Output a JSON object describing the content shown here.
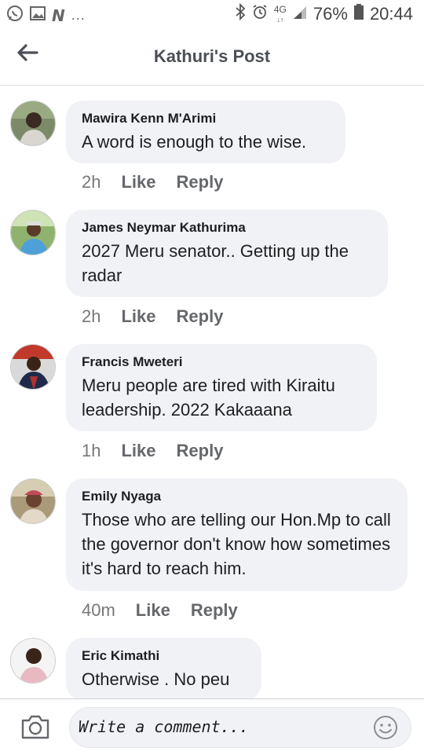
{
  "status_bar": {
    "icons_left": [
      "whatsapp-icon",
      "image-icon",
      "n-icon"
    ],
    "n_glyph": "N",
    "more": "...",
    "icons_right": [
      "bluetooth-icon",
      "alarm-icon",
      "4g-icon",
      "signal-icon",
      "battery-icon"
    ],
    "network": "4G",
    "battery_percent": "76%",
    "time": "20:44"
  },
  "header": {
    "title": "Kathuri's Post"
  },
  "comments": [
    {
      "author": "Mawira Kenn M'Arimi",
      "text": "A word is enough to the wise.",
      "time": "2h",
      "like_label": "Like",
      "reply_label": "Reply"
    },
    {
      "author": "James Neymar Kathurima",
      "text": "2027 Meru senator.. Getting up the radar",
      "time": "2h",
      "like_label": "Like",
      "reply_label": "Reply"
    },
    {
      "author": "Francis Mweteri",
      "text": "Meru people are tired with Kiraitu leadership. 2022 Kakaaana",
      "time": "1h",
      "like_label": "Like",
      "reply_label": "Reply"
    },
    {
      "author": "Emily Nyaga",
      "text": "Those who are telling our  Hon.Mp to call  the governor  don't know how sometimes it's hard to reach him.",
      "time": "40m",
      "like_label": "Like",
      "reply_label": "Reply"
    },
    {
      "author": "Eric Kimathi",
      "text": "Otherwise .  No peu"
    }
  ],
  "composer": {
    "placeholder": "Write a comment..."
  },
  "colors": {
    "bubble_bg": "#f0f2f5",
    "meta_gray": "#65676b",
    "header_title": "#4b4f56"
  }
}
